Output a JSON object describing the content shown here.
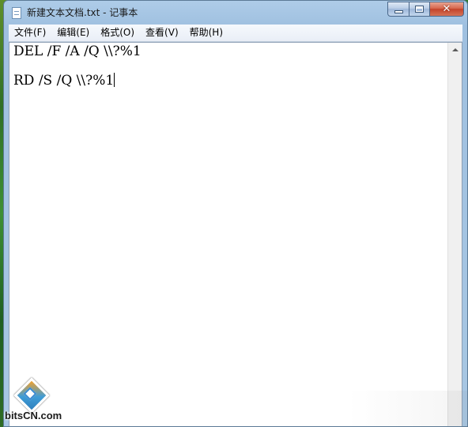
{
  "window": {
    "title": "新建文本文档.txt - 记事本",
    "icon": "notepad-icon"
  },
  "controls": {
    "minimize_icon": "minimize-icon",
    "maximize_icon": "maximize-icon",
    "close_icon": "close-icon",
    "close_glyph": "✕"
  },
  "menu": {
    "items": [
      {
        "label": "文件(F)"
      },
      {
        "label": "编辑(E)"
      },
      {
        "label": "格式(O)"
      },
      {
        "label": "查看(V)"
      },
      {
        "label": "帮助(H)"
      }
    ]
  },
  "editor": {
    "lines": [
      "DEL /F /A /Q \\\\?%1",
      "",
      "RD /S /Q \\\\?%1"
    ]
  },
  "watermark": {
    "text": "bitsCN.com"
  },
  "colors": {
    "title_bar": "#a8c7e3",
    "close_button": "#c4432a",
    "editor_bg": "#ffffff"
  }
}
